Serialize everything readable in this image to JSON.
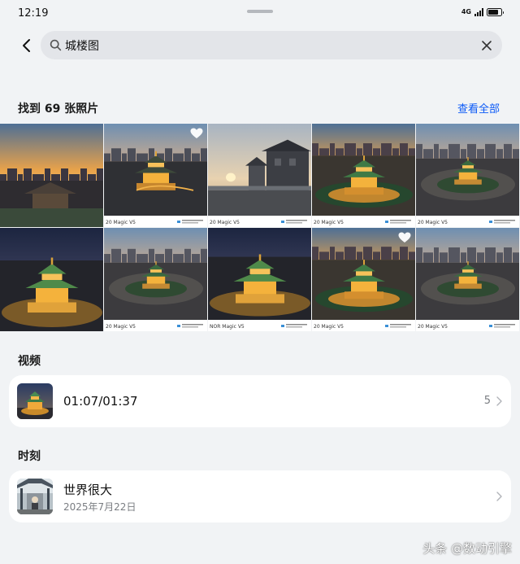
{
  "status_bar": {
    "time": "12:19",
    "network": "4G",
    "battery_level": 0.85
  },
  "search": {
    "query": "城楼图",
    "placeholder": ""
  },
  "photos": {
    "header": "找到 69 张照片",
    "view_all": "查看全部",
    "tiles": [
      {
        "scene": "sunset-cityscape",
        "favorite": false,
        "caption_left": "",
        "caption_right": ""
      },
      {
        "scene": "tower-dusk",
        "favorite": true,
        "caption_left": "20 Magic V5",
        "caption_right": ""
      },
      {
        "scene": "city-gate",
        "favorite": false,
        "caption_left": "20 Magic V5",
        "caption_right": ""
      },
      {
        "scene": "tower-sunset",
        "favorite": false,
        "caption_left": "20 Magic V5",
        "caption_right": ""
      },
      {
        "scene": "tower-roundabout",
        "favorite": false,
        "caption_left": "20 Magic V5",
        "caption_right": ""
      },
      {
        "scene": "tower-night-close",
        "favorite": false,
        "caption_left": "",
        "caption_right": ""
      },
      {
        "scene": "tower-roundabout",
        "favorite": false,
        "caption_left": "20 Magic V5",
        "caption_right": ""
      },
      {
        "scene": "tower-night-close",
        "favorite": false,
        "caption_left": "NOR Magic V5",
        "caption_right": ""
      },
      {
        "scene": "tower-sunset",
        "favorite": true,
        "caption_left": "20 Magic V5",
        "caption_right": ""
      },
      {
        "scene": "tower-roundabout",
        "favorite": false,
        "caption_left": "20 Magic V5",
        "caption_right": ""
      }
    ]
  },
  "videos": {
    "header": "视频",
    "item": {
      "title": "01:07/01:37",
      "count": "5"
    }
  },
  "moments": {
    "header": "时刻",
    "item": {
      "title": "世界很大",
      "date": "2025年7月22日"
    }
  },
  "watermark": "头条 @数动引擎",
  "colors": {
    "accent": "#0a59f7",
    "background": "#f1f3f5",
    "card": "#ffffff"
  }
}
